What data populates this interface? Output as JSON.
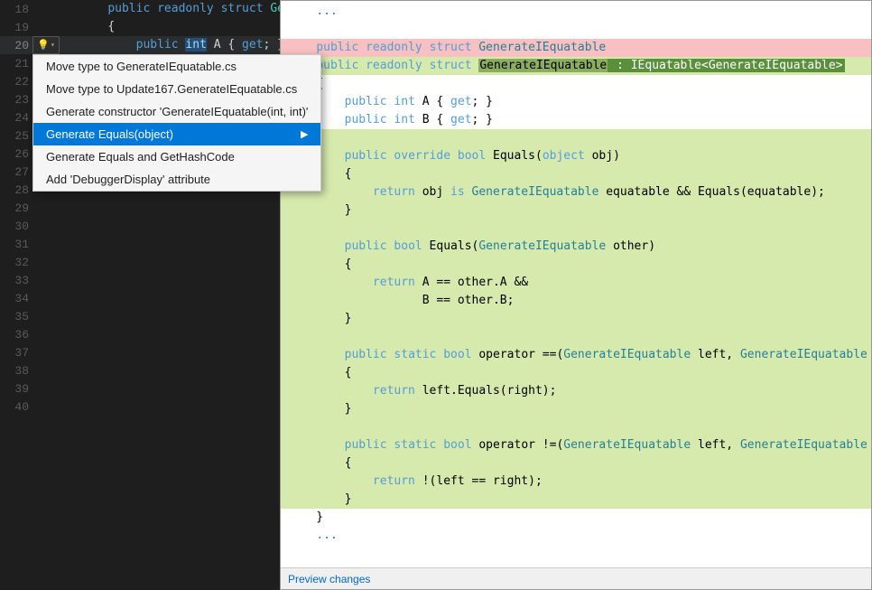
{
  "editor": {
    "lines": [
      {
        "num": 18,
        "ind1": "",
        "ind2": "",
        "ind3": "",
        "code": "    public readonly struct GenerateIEquatable",
        "highlighted": false
      },
      {
        "num": 19,
        "ind1": "",
        "ind2": "",
        "ind3": "",
        "code": "    {",
        "highlighted": false
      },
      {
        "num": 20,
        "ind1": "bulb",
        "ind2": "",
        "ind3": "",
        "code": "        public int A { get; }",
        "highlighted": true
      },
      {
        "num": 21,
        "ind1": "",
        "ind2": "",
        "ind3": "",
        "code": "",
        "highlighted": false
      },
      {
        "num": 22,
        "ind1": "",
        "ind2": "",
        "ind3": "",
        "code": "",
        "highlighted": false
      },
      {
        "num": 23,
        "ind1": "",
        "ind2": "",
        "ind3": "",
        "code": "",
        "highlighted": false
      },
      {
        "num": 24,
        "ind1": "",
        "ind2": "",
        "ind3": "",
        "code": "",
        "highlighted": false
      },
      {
        "num": 25,
        "ind1": "",
        "ind2": "",
        "ind3": "",
        "code": "",
        "highlighted": false
      },
      {
        "num": 26,
        "ind1": "",
        "ind2": "",
        "ind3": "",
        "code": "",
        "highlighted": false
      },
      {
        "num": 27,
        "ind1": "",
        "ind2": "",
        "ind3": "",
        "code": "",
        "highlighted": false
      },
      {
        "num": 28,
        "ind1": "",
        "ind2": "",
        "ind3": "",
        "code": "",
        "highlighted": false
      },
      {
        "num": 29,
        "ind1": "",
        "ind2": "",
        "ind3": "",
        "code": "",
        "highlighted": false
      },
      {
        "num": 30,
        "ind1": "",
        "ind2": "",
        "ind3": "",
        "code": "",
        "highlighted": false
      },
      {
        "num": 31,
        "ind1": "",
        "ind2": "",
        "ind3": "",
        "code": "",
        "highlighted": false
      },
      {
        "num": 32,
        "ind1": "",
        "ind2": "",
        "ind3": "",
        "code": "",
        "highlighted": false
      },
      {
        "num": 33,
        "ind1": "",
        "ind2": "",
        "ind3": "",
        "code": "",
        "highlighted": false
      },
      {
        "num": 34,
        "ind1": "",
        "ind2": "",
        "ind3": "",
        "code": "",
        "highlighted": false
      },
      {
        "num": 35,
        "ind1": "",
        "ind2": "",
        "ind3": "",
        "code": "",
        "highlighted": false
      },
      {
        "num": 36,
        "ind1": "",
        "ind2": "",
        "ind3": "",
        "code": "",
        "highlighted": false
      },
      {
        "num": 37,
        "ind1": "",
        "ind2": "",
        "ind3": "",
        "code": "",
        "highlighted": false
      },
      {
        "num": 38,
        "ind1": "",
        "ind2": "",
        "ind3": "",
        "code": "",
        "highlighted": false
      },
      {
        "num": 39,
        "ind1": "",
        "ind2": "",
        "ind3": "",
        "code": "",
        "highlighted": false
      },
      {
        "num": 40,
        "ind1": "",
        "ind2": "",
        "ind3": "",
        "code": "",
        "highlighted": false
      }
    ]
  },
  "lightbulb": {
    "icon": "💡",
    "dropdown_arrow": "▼",
    "menu_items": [
      {
        "id": "move-type",
        "label": "Move type to GenerateIEquatable.cs",
        "has_submenu": false,
        "active": false
      },
      {
        "id": "move-type-update",
        "label": "Move type to Update167.GenerateIEquatable.cs",
        "has_submenu": false,
        "active": false
      },
      {
        "id": "generate-constructor",
        "label": "Generate constructor 'GenerateIEquatable(int, int)'",
        "has_submenu": false,
        "active": false
      },
      {
        "id": "generate-equals",
        "label": "Generate Equals(object)",
        "has_submenu": true,
        "active": true
      },
      {
        "id": "generate-equals-hashcode",
        "label": "Generate Equals and GetHashCode",
        "has_submenu": false,
        "active": false
      },
      {
        "id": "add-debugger",
        "label": "Add 'DebuggerDisplay' attribute",
        "has_submenu": false,
        "active": false
      }
    ]
  },
  "preview": {
    "lines": [
      {
        "type": "normal",
        "text": "    ..."
      },
      {
        "type": "normal",
        "text": ""
      },
      {
        "type": "removed",
        "text": "    public readonly struct GenerateIEquatable"
      },
      {
        "type": "added_inl",
        "text": "    public readonly struct GenerateIEquatable : IEquatable<GenerateIEquatable>",
        "removed_part": "GenerateIEquatable",
        "added_part": " : IEquatable<GenerateIEquatable>"
      },
      {
        "type": "normal",
        "text": "    {"
      },
      {
        "type": "normal",
        "text": "        public int A { get; }"
      },
      {
        "type": "normal",
        "text": "        public int B { get; }"
      },
      {
        "type": "normal",
        "text": ""
      },
      {
        "type": "added",
        "text": "        public override bool Equals(object obj)"
      },
      {
        "type": "added",
        "text": "        {"
      },
      {
        "type": "added",
        "text": "            return obj is GenerateIEquatable equatable && Equals(equatable);"
      },
      {
        "type": "added",
        "text": "        }"
      },
      {
        "type": "added",
        "text": ""
      },
      {
        "type": "added",
        "text": "        public bool Equals(GenerateIEquatable other)"
      },
      {
        "type": "added",
        "text": "        {"
      },
      {
        "type": "added",
        "text": "            return A == other.A &&"
      },
      {
        "type": "added",
        "text": "                   B == other.B;"
      },
      {
        "type": "added",
        "text": "        }"
      },
      {
        "type": "added",
        "text": ""
      },
      {
        "type": "added",
        "text": "        public static bool operator ==(GenerateIEquatable left, GenerateIEquatable right)"
      },
      {
        "type": "added",
        "text": "        {"
      },
      {
        "type": "added",
        "text": "            return left.Equals(right);"
      },
      {
        "type": "added",
        "text": "        }"
      },
      {
        "type": "added",
        "text": ""
      },
      {
        "type": "added",
        "text": "        public static bool operator !=(GenerateIEquatable left, GenerateIEquatable right)"
      },
      {
        "type": "added",
        "text": "        {"
      },
      {
        "type": "added",
        "text": "            return !(left == right);"
      },
      {
        "type": "added",
        "text": "        }"
      },
      {
        "type": "normal",
        "text": "    }"
      },
      {
        "type": "normal",
        "text": "    ..."
      }
    ],
    "footer_link": "Preview changes"
  }
}
